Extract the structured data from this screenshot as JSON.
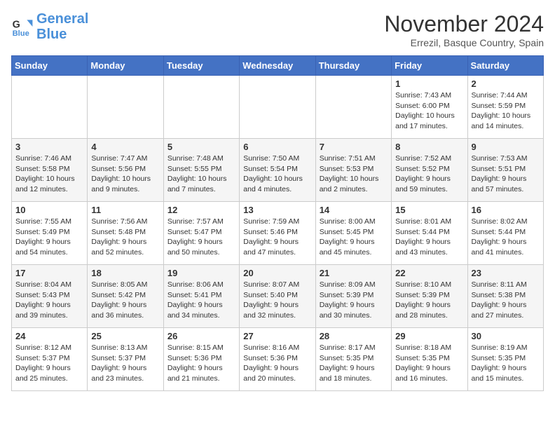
{
  "logo": {
    "line1": "General",
    "line2": "Blue"
  },
  "title": "November 2024",
  "location": "Errezil, Basque Country, Spain",
  "headers": [
    "Sunday",
    "Monday",
    "Tuesday",
    "Wednesday",
    "Thursday",
    "Friday",
    "Saturday"
  ],
  "weeks": [
    [
      {
        "day": "",
        "info": ""
      },
      {
        "day": "",
        "info": ""
      },
      {
        "day": "",
        "info": ""
      },
      {
        "day": "",
        "info": ""
      },
      {
        "day": "",
        "info": ""
      },
      {
        "day": "1",
        "info": "Sunrise: 7:43 AM\nSunset: 6:00 PM\nDaylight: 10 hours and 17 minutes."
      },
      {
        "day": "2",
        "info": "Sunrise: 7:44 AM\nSunset: 5:59 PM\nDaylight: 10 hours and 14 minutes."
      }
    ],
    [
      {
        "day": "3",
        "info": "Sunrise: 7:46 AM\nSunset: 5:58 PM\nDaylight: 10 hours and 12 minutes."
      },
      {
        "day": "4",
        "info": "Sunrise: 7:47 AM\nSunset: 5:56 PM\nDaylight: 10 hours and 9 minutes."
      },
      {
        "day": "5",
        "info": "Sunrise: 7:48 AM\nSunset: 5:55 PM\nDaylight: 10 hours and 7 minutes."
      },
      {
        "day": "6",
        "info": "Sunrise: 7:50 AM\nSunset: 5:54 PM\nDaylight: 10 hours and 4 minutes."
      },
      {
        "day": "7",
        "info": "Sunrise: 7:51 AM\nSunset: 5:53 PM\nDaylight: 10 hours and 2 minutes."
      },
      {
        "day": "8",
        "info": "Sunrise: 7:52 AM\nSunset: 5:52 PM\nDaylight: 9 hours and 59 minutes."
      },
      {
        "day": "9",
        "info": "Sunrise: 7:53 AM\nSunset: 5:51 PM\nDaylight: 9 hours and 57 minutes."
      }
    ],
    [
      {
        "day": "10",
        "info": "Sunrise: 7:55 AM\nSunset: 5:49 PM\nDaylight: 9 hours and 54 minutes."
      },
      {
        "day": "11",
        "info": "Sunrise: 7:56 AM\nSunset: 5:48 PM\nDaylight: 9 hours and 52 minutes."
      },
      {
        "day": "12",
        "info": "Sunrise: 7:57 AM\nSunset: 5:47 PM\nDaylight: 9 hours and 50 minutes."
      },
      {
        "day": "13",
        "info": "Sunrise: 7:59 AM\nSunset: 5:46 PM\nDaylight: 9 hours and 47 minutes."
      },
      {
        "day": "14",
        "info": "Sunrise: 8:00 AM\nSunset: 5:45 PM\nDaylight: 9 hours and 45 minutes."
      },
      {
        "day": "15",
        "info": "Sunrise: 8:01 AM\nSunset: 5:44 PM\nDaylight: 9 hours and 43 minutes."
      },
      {
        "day": "16",
        "info": "Sunrise: 8:02 AM\nSunset: 5:44 PM\nDaylight: 9 hours and 41 minutes."
      }
    ],
    [
      {
        "day": "17",
        "info": "Sunrise: 8:04 AM\nSunset: 5:43 PM\nDaylight: 9 hours and 39 minutes."
      },
      {
        "day": "18",
        "info": "Sunrise: 8:05 AM\nSunset: 5:42 PM\nDaylight: 9 hours and 36 minutes."
      },
      {
        "day": "19",
        "info": "Sunrise: 8:06 AM\nSunset: 5:41 PM\nDaylight: 9 hours and 34 minutes."
      },
      {
        "day": "20",
        "info": "Sunrise: 8:07 AM\nSunset: 5:40 PM\nDaylight: 9 hours and 32 minutes."
      },
      {
        "day": "21",
        "info": "Sunrise: 8:09 AM\nSunset: 5:39 PM\nDaylight: 9 hours and 30 minutes."
      },
      {
        "day": "22",
        "info": "Sunrise: 8:10 AM\nSunset: 5:39 PM\nDaylight: 9 hours and 28 minutes."
      },
      {
        "day": "23",
        "info": "Sunrise: 8:11 AM\nSunset: 5:38 PM\nDaylight: 9 hours and 27 minutes."
      }
    ],
    [
      {
        "day": "24",
        "info": "Sunrise: 8:12 AM\nSunset: 5:37 PM\nDaylight: 9 hours and 25 minutes."
      },
      {
        "day": "25",
        "info": "Sunrise: 8:13 AM\nSunset: 5:37 PM\nDaylight: 9 hours and 23 minutes."
      },
      {
        "day": "26",
        "info": "Sunrise: 8:15 AM\nSunset: 5:36 PM\nDaylight: 9 hours and 21 minutes."
      },
      {
        "day": "27",
        "info": "Sunrise: 8:16 AM\nSunset: 5:36 PM\nDaylight: 9 hours and 20 minutes."
      },
      {
        "day": "28",
        "info": "Sunrise: 8:17 AM\nSunset: 5:35 PM\nDaylight: 9 hours and 18 minutes."
      },
      {
        "day": "29",
        "info": "Sunrise: 8:18 AM\nSunset: 5:35 PM\nDaylight: 9 hours and 16 minutes."
      },
      {
        "day": "30",
        "info": "Sunrise: 8:19 AM\nSunset: 5:35 PM\nDaylight: 9 hours and 15 minutes."
      }
    ]
  ]
}
